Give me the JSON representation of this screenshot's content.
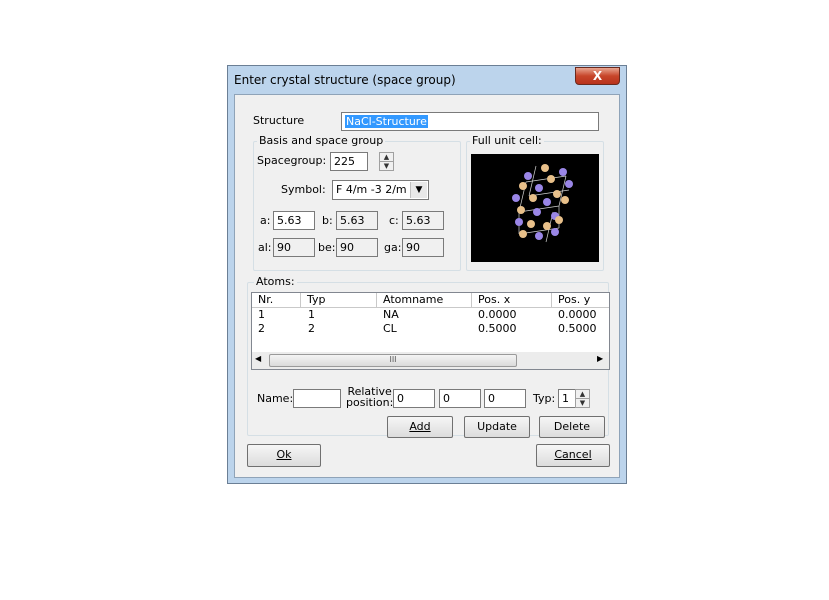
{
  "window": {
    "title": "Enter crystal structure (space group)",
    "close_glyph": "X"
  },
  "structure": {
    "label": "Structure",
    "value": "NaCl-Structure"
  },
  "basis_group": {
    "label": "Basis and space group",
    "spacegroup_label": "Spacegroup:",
    "spacegroup_value": "225",
    "symbol_label": "Symbol:",
    "symbol_value": "F 4/m -3 2/m",
    "a_label": "a:",
    "a_value": "5.63",
    "b_label": "b:",
    "b_value": "5.63",
    "c_label": "c:",
    "c_value": "5.63",
    "al_label": "al:",
    "al_value": "90",
    "be_label": "be:",
    "be_value": "90",
    "ga_label": "ga:",
    "ga_value": "90"
  },
  "unit_cell": {
    "label": "Full unit cell:",
    "na_color": "#9a86e6",
    "cl_color": "#e8c08a"
  },
  "atoms": {
    "label": "Atoms:",
    "columns": [
      "Nr.",
      "Typ",
      "Atomname",
      "Pos. x",
      "Pos. y"
    ],
    "rows": [
      [
        "1",
        "1",
        "NA",
        "0.0000",
        "0.0000"
      ],
      [
        "2",
        "2",
        "CL",
        "0.5000",
        "0.5000"
      ]
    ],
    "scroll_grip": "III",
    "name_label": "Name:",
    "name_value": "",
    "relpos_label_1": "Relative",
    "relpos_label_2": "position:",
    "pos_x": "0",
    "pos_y": "0",
    "pos_z": "0",
    "typ_label": "Typ:",
    "typ_value": "1",
    "add_label": "Add",
    "update_label": "Update",
    "delete_label": "Delete"
  },
  "buttons": {
    "ok_label": "Ok",
    "cancel_label": "Cancel"
  }
}
